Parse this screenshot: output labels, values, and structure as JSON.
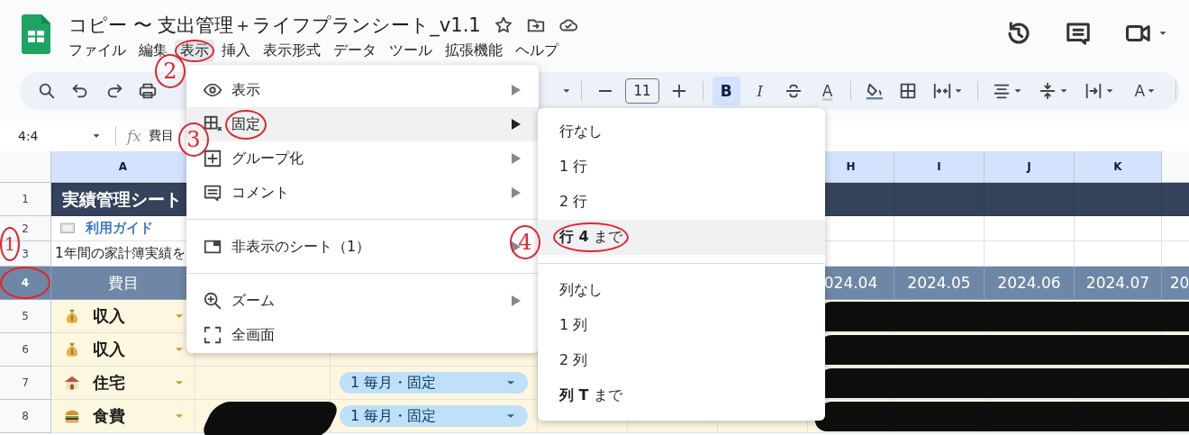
{
  "app": {
    "title": "コピー 〜 支出管理＋ライフプランシート_v1.1",
    "menus": [
      {
        "label": "ファイル",
        "selected": false,
        "circled": false
      },
      {
        "label": "編集",
        "selected": false,
        "circled": false
      },
      {
        "label": "表示",
        "selected": true,
        "circled": true
      },
      {
        "label": "挿入",
        "selected": false,
        "circled": false
      },
      {
        "label": "表示形式",
        "selected": false,
        "circled": false
      },
      {
        "label": "データ",
        "selected": false,
        "circled": false
      },
      {
        "label": "ツール",
        "selected": false,
        "circled": false
      },
      {
        "label": "拡張機能",
        "selected": false,
        "circled": false
      },
      {
        "label": "ヘルプ",
        "selected": false,
        "circled": false
      }
    ]
  },
  "toolbar": {
    "font_size": "11",
    "bold": {
      "label": "B",
      "selected": true
    },
    "italic": {
      "label": "I",
      "selected": false
    },
    "text_color": {
      "label": "A"
    },
    "rotation": {
      "label": "A"
    }
  },
  "formula_bar": {
    "cell_ref": "4:4",
    "fx": "fx",
    "formula": "費目"
  },
  "sheet": {
    "columns": [
      {
        "letter": "A",
        "selected": true
      },
      {
        "letter": "H",
        "selected": true
      },
      {
        "letter": "I",
        "selected": true
      },
      {
        "letter": "J",
        "selected": true
      },
      {
        "letter": "K",
        "selected": true
      }
    ],
    "rows": [
      {
        "number": "1",
        "kind": "title",
        "selected": false,
        "circled": false,
        "title": "実績管理シート"
      },
      {
        "number": "2",
        "kind": "link",
        "selected": false,
        "circled": false,
        "link": "利用ガイド"
      },
      {
        "number": "3",
        "kind": "note",
        "selected": false,
        "circled": false,
        "note": "1年間の家計簿実績を"
      },
      {
        "number": "4",
        "kind": "header",
        "selected": true,
        "circled": true,
        "label": "費目",
        "months": [
          "024.04",
          "2024.05",
          "2024.06",
          "2024.07",
          "20"
        ]
      },
      {
        "number": "5",
        "kind": "category",
        "selected": false,
        "circled": false,
        "label": "収入",
        "redacted": true
      },
      {
        "number": "6",
        "kind": "category",
        "selected": false,
        "circled": false,
        "label": "収入",
        "redacted": true
      },
      {
        "number": "7",
        "kind": "category",
        "selected": false,
        "circled": false,
        "label": "住宅",
        "redacted": true,
        "plan": "1 毎月・固定"
      },
      {
        "number": "8",
        "kind": "category",
        "selected": false,
        "circled": false,
        "label": "食費",
        "redacted": true,
        "plan": "1 毎月・固定",
        "b_redacted": true
      }
    ]
  },
  "view_menu": {
    "items": [
      {
        "kind": "item",
        "label": "表示",
        "submenu": true,
        "selected": false,
        "circled": false
      },
      {
        "kind": "item",
        "label": "固定",
        "submenu": true,
        "selected": true,
        "circled": true
      },
      {
        "kind": "item",
        "label": "グループ化",
        "submenu": true,
        "selected": false,
        "circled": false
      },
      {
        "kind": "item",
        "label": "コメント",
        "submenu": true,
        "selected": false,
        "circled": false
      },
      {
        "kind": "separator"
      },
      {
        "kind": "item",
        "label": "非表示のシート（1）",
        "submenu": true,
        "selected": false,
        "circled": false
      },
      {
        "kind": "separator"
      },
      {
        "kind": "item",
        "label": "ズーム",
        "submenu": true,
        "selected": false,
        "circled": false
      },
      {
        "kind": "item",
        "label": "全画面",
        "submenu": false,
        "selected": false,
        "circled": false
      }
    ]
  },
  "freeze_menu": {
    "items": [
      {
        "kind": "item",
        "label": "行なし",
        "selected": false,
        "circled": false
      },
      {
        "kind": "item",
        "label": "1 行",
        "selected": false,
        "circled": false
      },
      {
        "kind": "item",
        "label": "2 行",
        "selected": false,
        "circled": false
      },
      {
        "kind": "item",
        "label": "**行 4** まで",
        "selected": true,
        "circled": true
      },
      {
        "kind": "separator"
      },
      {
        "kind": "item",
        "label": "列なし",
        "selected": false,
        "circled": false
      },
      {
        "kind": "item",
        "label": "1 列",
        "selected": false,
        "circled": false
      },
      {
        "kind": "item",
        "label": "2 列",
        "selected": false,
        "circled": false
      },
      {
        "kind": "item",
        "label": "**列 T** まで",
        "selected": false,
        "circled": false
      }
    ]
  },
  "annotations": [
    {
      "label": "1"
    },
    {
      "label": "2"
    },
    {
      "label": "3"
    },
    {
      "label": "4"
    }
  ]
}
